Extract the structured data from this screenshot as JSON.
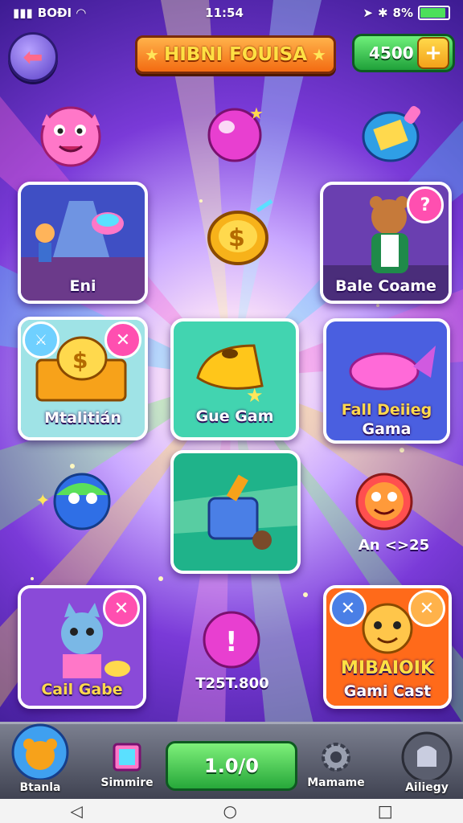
{
  "status_bar": {
    "left": "BOĐI",
    "time": "11:54",
    "battery": "8%",
    "battery_level": 0.86
  },
  "header": {
    "title": "HIBNI FOUISA",
    "coins": "4500",
    "coins_add": "+"
  },
  "cards": [
    {
      "label": "Eni"
    },
    {
      "label": "Bale Coame",
      "badge": "?"
    },
    {
      "label": "Mtalitián",
      "badge": "✕"
    },
    {
      "label": "Gue Gam"
    },
    {
      "label_line1": "Fall Deiieg",
      "label_line2": "Gama"
    },
    {
      "label": ""
    },
    {
      "label": "Cail Gabe",
      "badge": "✕"
    },
    {
      "label_line1": "MIBAIOIK",
      "label_line2": "Gami Cast",
      "badge_left": "✕",
      "badge_right": "✕"
    }
  ],
  "floating_labels": {
    "ball_right": "An <>25",
    "bomb_center": "T25T.800"
  },
  "bottom_nav": {
    "home": "Btanla",
    "shop": "Simmire",
    "play_value": "1.0/0",
    "settings": "Mamame",
    "history": "Ailiegy"
  },
  "colors": {
    "accent": "#f36b12",
    "green": "#35c24a",
    "purple": "#7a3ad8"
  }
}
